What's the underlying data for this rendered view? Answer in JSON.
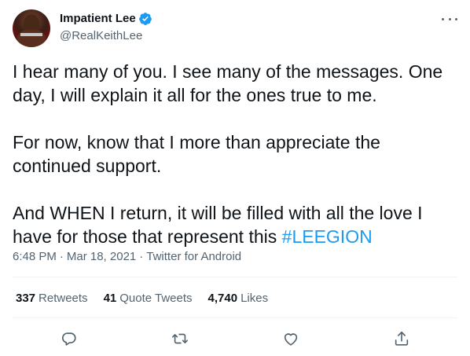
{
  "author": {
    "display_name": "Impatient Lee",
    "handle": "@RealKeithLee",
    "verified": true,
    "verified_color": "#1d9bf0"
  },
  "tweet": {
    "paragraphs": [
      "I hear many of you. I see many of the messages. One day, I will explain it all for the ones true to me.",
      "For now, know that I more than appreciate the continued support.",
      "And WHEN I return, it will be filled with all the love I have for those that represent this "
    ],
    "hashtag": "#LEEGION"
  },
  "meta": {
    "time": "6:48 PM",
    "separator": "·",
    "date": "Mar 18, 2021",
    "source": "Twitter for Android"
  },
  "stats": {
    "retweets": {
      "count": "337",
      "label": "Retweets"
    },
    "quote_tweets": {
      "count": "41",
      "label": "Quote Tweets"
    },
    "likes": {
      "count": "4,740",
      "label": "Likes"
    }
  },
  "icons": {
    "more": "more-horizontal-icon",
    "reply": "reply-icon",
    "retweet": "retweet-icon",
    "like": "heart-icon",
    "share": "share-icon"
  },
  "colors": {
    "text": "#0f1419",
    "secondary": "#536471",
    "accent": "#1d9bf0",
    "divider": "#eff3f4"
  }
}
